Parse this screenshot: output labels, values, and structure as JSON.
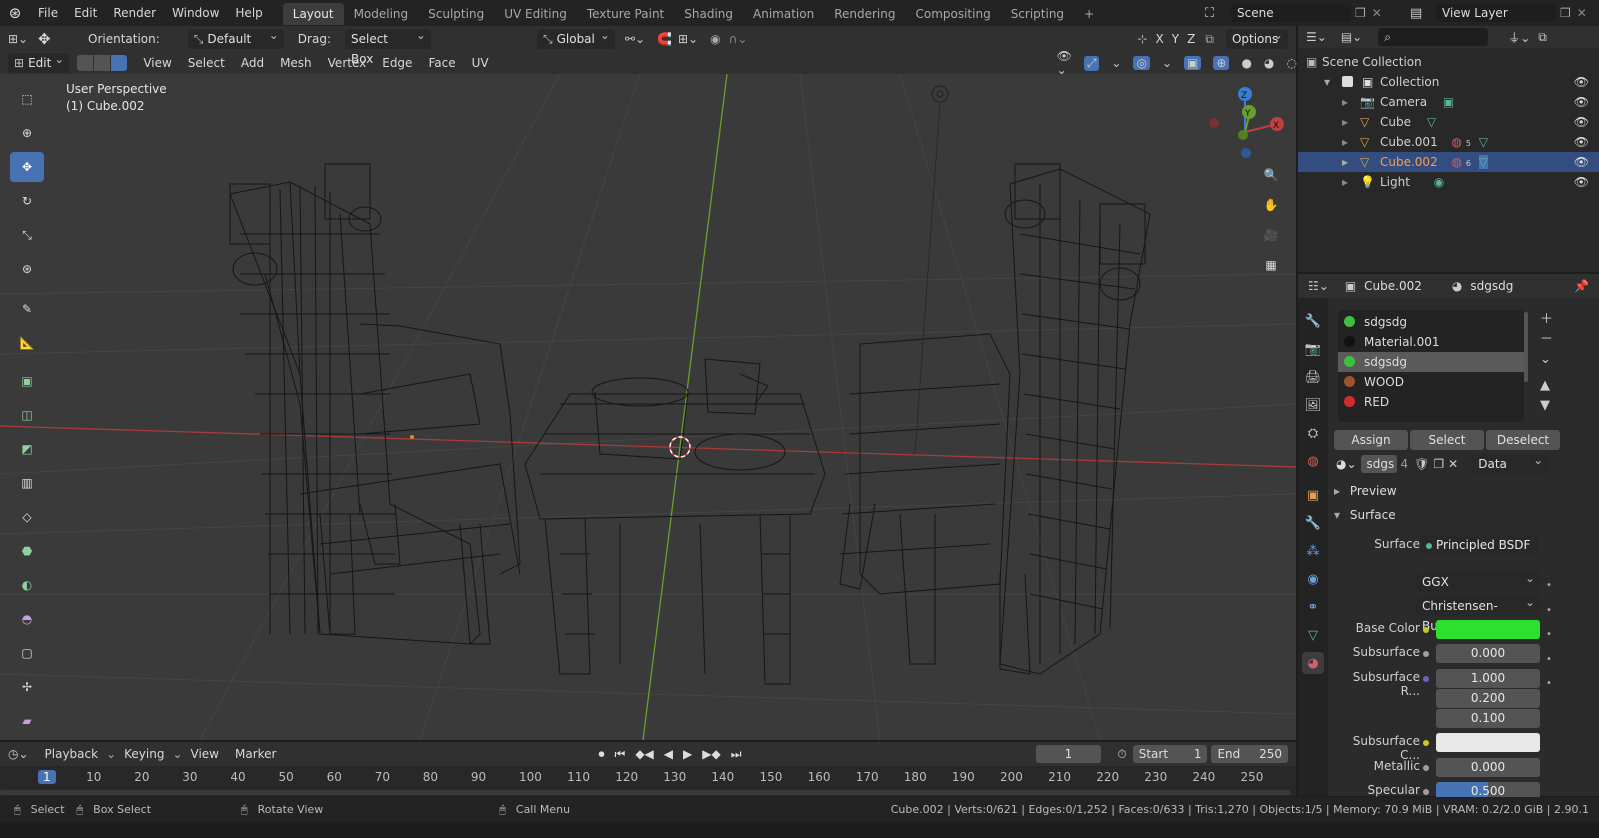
{
  "menubar": {
    "items": [
      "File",
      "Edit",
      "Render",
      "Window",
      "Help"
    ],
    "workspaces": [
      "Layout",
      "Modeling",
      "Sculpting",
      "UV Editing",
      "Texture Paint",
      "Shading",
      "Animation",
      "Rendering",
      "Compositing",
      "Scripting"
    ],
    "add_tab": "+",
    "scene_label": "Scene",
    "view_layer_label": "View Layer"
  },
  "tool_header": {
    "orientation_label": "Orientation:",
    "orientation_value": "Default",
    "drag_label": "Drag:",
    "drag_value": "Select Box",
    "transform_orientation": "Global",
    "axes": [
      "X",
      "Y",
      "Z"
    ],
    "options_label": "Options"
  },
  "viewport_header": {
    "mode": "Edit Mode",
    "menus": [
      "View",
      "Select",
      "Add",
      "Mesh",
      "Vertex",
      "Edge",
      "Face",
      "UV"
    ]
  },
  "viewport": {
    "perspective_label": "User Perspective",
    "object_label": "(1) Cube.002",
    "gizmo_axes": [
      "X",
      "Y",
      "Z"
    ]
  },
  "outliner": {
    "scene_collection": "Scene Collection",
    "collection": "Collection",
    "items": [
      {
        "name": "Camera",
        "selected": false,
        "badge": ""
      },
      {
        "name": "Cube",
        "selected": false,
        "badge": ""
      },
      {
        "name": "Cube.001",
        "selected": false,
        "badge": "5"
      },
      {
        "name": "Cube.002",
        "selected": true,
        "badge": "6"
      },
      {
        "name": "Light",
        "selected": false,
        "badge": ""
      }
    ]
  },
  "properties": {
    "object_name": "Cube.002",
    "material_name": "sdgsdg",
    "material_slots": [
      {
        "name": "sdgsdg",
        "color": "#3fbf3f",
        "selected": false
      },
      {
        "name": "Material.001",
        "color": "#111111",
        "selected": false
      },
      {
        "name": "sdgsdg",
        "color": "#3fbf3f",
        "selected": true
      },
      {
        "name": "WOOD",
        "color": "#a0522d",
        "selected": false
      },
      {
        "name": "RED",
        "color": "#d62b2b",
        "selected": false
      }
    ],
    "assign_label": "Assign",
    "select_label": "Select",
    "deselect_label": "Deselect",
    "datablock_name": "sdgs",
    "datablock_users": "4",
    "link_value": "Data",
    "preview_label": "Preview",
    "surface_section": "Surface",
    "surface_label": "Surface",
    "surface_value": "Principled BSDF",
    "distribution": "GGX",
    "subsurface_method": "Christensen-Burley",
    "base_color_label": "Base Color",
    "base_color": "#2de02d",
    "subsurface_label": "Subsurface",
    "subsurface_value": "0.000",
    "subsurface_radius_label": "Subsurface R...",
    "subsurface_radius": [
      "1.000",
      "0.200",
      "0.100"
    ],
    "subsurface_color_label": "Subsurface C...",
    "subsurface_color": "#e8e8e8",
    "metallic_label": "Metallic",
    "metallic_value": "0.000",
    "specular_label": "Specular",
    "specular_value": "0.500",
    "specular_fraction": 0.5
  },
  "timeline": {
    "menus": [
      "Playback",
      "Keying",
      "View",
      "Marker"
    ],
    "current_frame": "1",
    "start_label": "Start",
    "start_value": "1",
    "end_label": "End",
    "end_value": "250",
    "ruler_frames": [
      "1",
      "10",
      "20",
      "30",
      "40",
      "50",
      "60",
      "70",
      "80",
      "90",
      "100",
      "110",
      "120",
      "130",
      "140",
      "150",
      "160",
      "170",
      "180",
      "190",
      "200",
      "210",
      "220",
      "230",
      "240",
      "250"
    ]
  },
  "statusbar": {
    "select": "Select",
    "box_select": "Box Select",
    "rotate_view": "Rotate View",
    "call_menu": "Call Menu",
    "stats": "Cube.002 | Verts:0/621 | Edges:0/1,252 | Faces:0/633 | Tris:1,270 | Objects:1/5 | Memory: 70.9 MiB | VRAM: 0.2/2.0 GiB | 2.90.1"
  },
  "colors": {
    "accent": "#4772b3",
    "selection": "#334d80",
    "x_axis": "#c04040",
    "y_axis": "#6a9e2f",
    "z_axis": "#3a7fd6"
  }
}
